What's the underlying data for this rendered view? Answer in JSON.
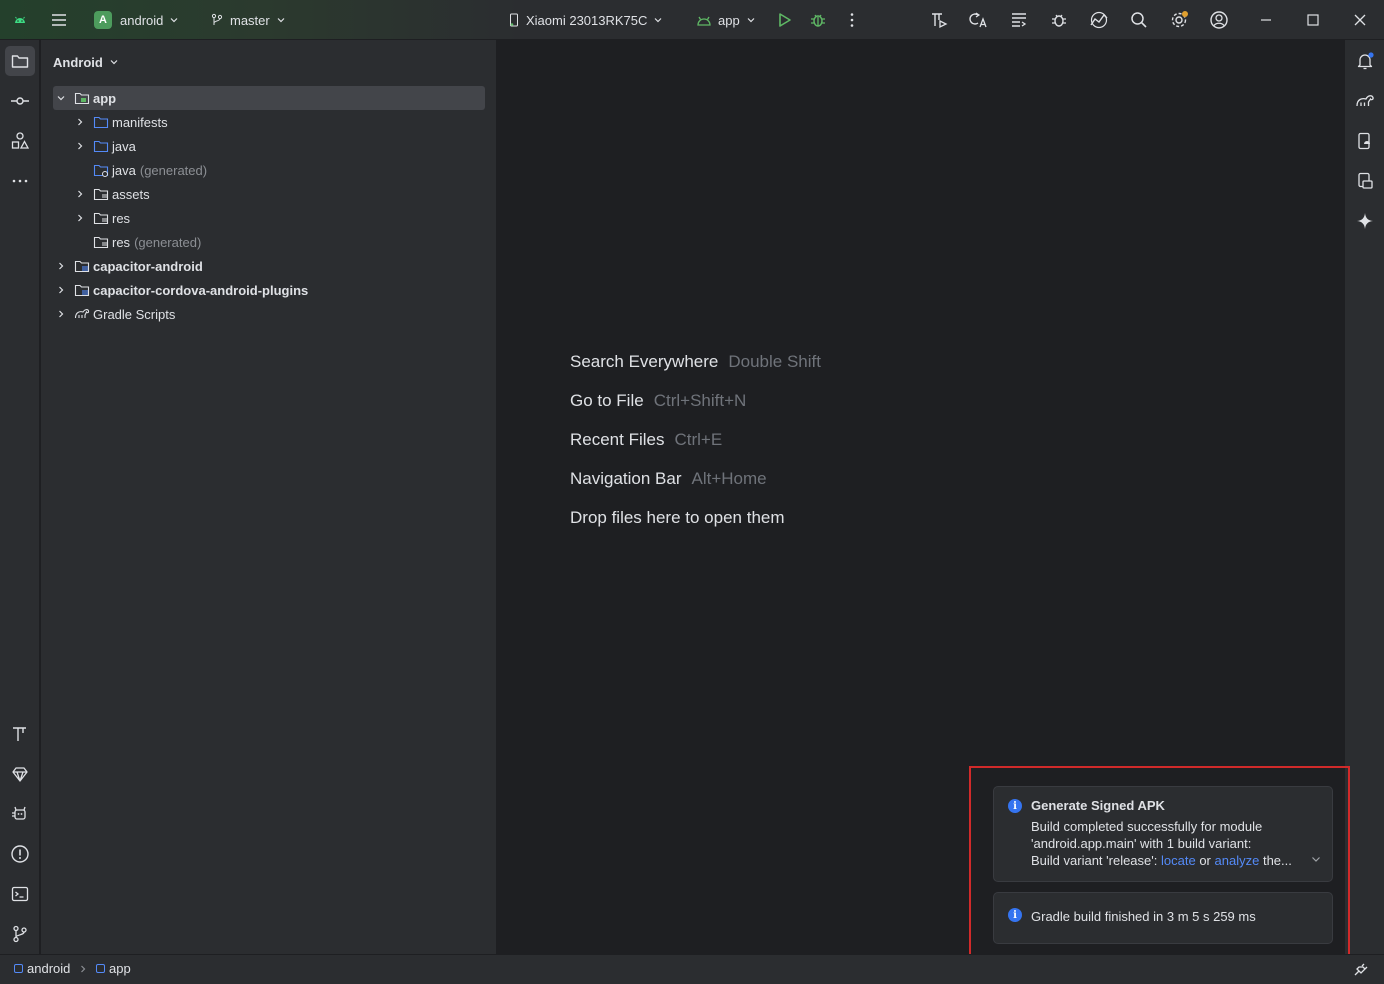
{
  "titlebar": {
    "project_badge": "A",
    "project_name": "android",
    "branch": "master",
    "device": "Xiaomi 23013RK75C",
    "run_config": "app"
  },
  "project_panel": {
    "view_mode": "Android",
    "tree": [
      {
        "label": "app",
        "bold": true,
        "suffix": ""
      },
      {
        "label": "manifests",
        "bold": false,
        "suffix": ""
      },
      {
        "label": "java",
        "bold": false,
        "suffix": ""
      },
      {
        "label": "java",
        "bold": false,
        "suffix": "(generated)"
      },
      {
        "label": "assets",
        "bold": false,
        "suffix": ""
      },
      {
        "label": "res",
        "bold": false,
        "suffix": ""
      },
      {
        "label": "res",
        "bold": false,
        "suffix": "(generated)"
      },
      {
        "label": "capacitor-android",
        "bold": true,
        "suffix": ""
      },
      {
        "label": "capacitor-cordova-android-plugins",
        "bold": true,
        "suffix": ""
      },
      {
        "label": "Gradle Scripts",
        "bold": false,
        "suffix": ""
      }
    ]
  },
  "editor": {
    "hints": [
      {
        "action": "Search Everywhere",
        "shortcut": "Double Shift"
      },
      {
        "action": "Go to File",
        "shortcut": "Ctrl+Shift+N"
      },
      {
        "action": "Recent Files",
        "shortcut": "Ctrl+E"
      },
      {
        "action": "Navigation Bar",
        "shortcut": "Alt+Home"
      },
      {
        "action": "Drop files here to open them",
        "shortcut": ""
      }
    ]
  },
  "notifications": {
    "signed_apk": {
      "title": "Generate Signed APK",
      "line1": "Build completed successfully for module",
      "line2": "'android.app.main' with 1 build variant:",
      "line3_prefix": "Build variant 'release':",
      "locate_link": "locate",
      "or_text": "or",
      "analyze_link": "analyze",
      "line3_suffix": "the..."
    },
    "gradle": {
      "text": "Gradle build finished in 3 m 5 s 259 ms"
    }
  },
  "statusbar": {
    "crumbs": [
      "android",
      "app"
    ]
  },
  "colors": {
    "accent": "#3574f0",
    "link": "#548af7",
    "highlight_frame": "#d12a2a",
    "run_green": "#5fb865"
  }
}
